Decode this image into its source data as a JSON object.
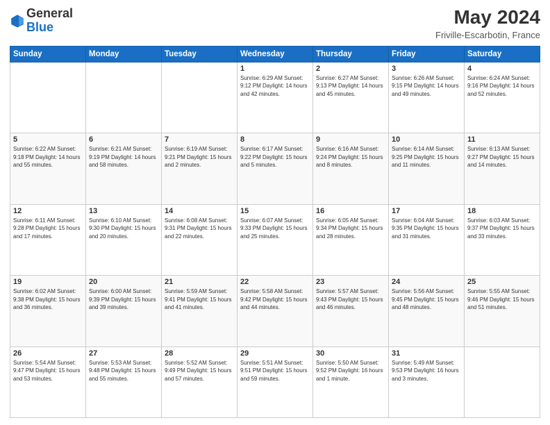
{
  "header": {
    "logo_general": "General",
    "logo_blue": "Blue",
    "title": "May 2024",
    "location": "Friville-Escarbotin, France"
  },
  "weekdays": [
    "Sunday",
    "Monday",
    "Tuesday",
    "Wednesday",
    "Thursday",
    "Friday",
    "Saturday"
  ],
  "weeks": [
    [
      {
        "day": "",
        "info": ""
      },
      {
        "day": "",
        "info": ""
      },
      {
        "day": "",
        "info": ""
      },
      {
        "day": "1",
        "info": "Sunrise: 6:29 AM\nSunset: 9:12 PM\nDaylight: 14 hours\nand 42 minutes."
      },
      {
        "day": "2",
        "info": "Sunrise: 6:27 AM\nSunset: 9:13 PM\nDaylight: 14 hours\nand 45 minutes."
      },
      {
        "day": "3",
        "info": "Sunrise: 6:26 AM\nSunset: 9:15 PM\nDaylight: 14 hours\nand 49 minutes."
      },
      {
        "day": "4",
        "info": "Sunrise: 6:24 AM\nSunset: 9:16 PM\nDaylight: 14 hours\nand 52 minutes."
      }
    ],
    [
      {
        "day": "5",
        "info": "Sunrise: 6:22 AM\nSunset: 9:18 PM\nDaylight: 14 hours\nand 55 minutes."
      },
      {
        "day": "6",
        "info": "Sunrise: 6:21 AM\nSunset: 9:19 PM\nDaylight: 14 hours\nand 58 minutes."
      },
      {
        "day": "7",
        "info": "Sunrise: 6:19 AM\nSunset: 9:21 PM\nDaylight: 15 hours\nand 2 minutes."
      },
      {
        "day": "8",
        "info": "Sunrise: 6:17 AM\nSunset: 9:22 PM\nDaylight: 15 hours\nand 5 minutes."
      },
      {
        "day": "9",
        "info": "Sunrise: 6:16 AM\nSunset: 9:24 PM\nDaylight: 15 hours\nand 8 minutes."
      },
      {
        "day": "10",
        "info": "Sunrise: 6:14 AM\nSunset: 9:25 PM\nDaylight: 15 hours\nand 11 minutes."
      },
      {
        "day": "11",
        "info": "Sunrise: 6:13 AM\nSunset: 9:27 PM\nDaylight: 15 hours\nand 14 minutes."
      }
    ],
    [
      {
        "day": "12",
        "info": "Sunrise: 6:11 AM\nSunset: 9:28 PM\nDaylight: 15 hours\nand 17 minutes."
      },
      {
        "day": "13",
        "info": "Sunrise: 6:10 AM\nSunset: 9:30 PM\nDaylight: 15 hours\nand 20 minutes."
      },
      {
        "day": "14",
        "info": "Sunrise: 6:08 AM\nSunset: 9:31 PM\nDaylight: 15 hours\nand 22 minutes."
      },
      {
        "day": "15",
        "info": "Sunrise: 6:07 AM\nSunset: 9:33 PM\nDaylight: 15 hours\nand 25 minutes."
      },
      {
        "day": "16",
        "info": "Sunrise: 6:05 AM\nSunset: 9:34 PM\nDaylight: 15 hours\nand 28 minutes."
      },
      {
        "day": "17",
        "info": "Sunrise: 6:04 AM\nSunset: 9:35 PM\nDaylight: 15 hours\nand 31 minutes."
      },
      {
        "day": "18",
        "info": "Sunrise: 6:03 AM\nSunset: 9:37 PM\nDaylight: 15 hours\nand 33 minutes."
      }
    ],
    [
      {
        "day": "19",
        "info": "Sunrise: 6:02 AM\nSunset: 9:38 PM\nDaylight: 15 hours\nand 36 minutes."
      },
      {
        "day": "20",
        "info": "Sunrise: 6:00 AM\nSunset: 9:39 PM\nDaylight: 15 hours\nand 39 minutes."
      },
      {
        "day": "21",
        "info": "Sunrise: 5:59 AM\nSunset: 9:41 PM\nDaylight: 15 hours\nand 41 minutes."
      },
      {
        "day": "22",
        "info": "Sunrise: 5:58 AM\nSunset: 9:42 PM\nDaylight: 15 hours\nand 44 minutes."
      },
      {
        "day": "23",
        "info": "Sunrise: 5:57 AM\nSunset: 9:43 PM\nDaylight: 15 hours\nand 46 minutes."
      },
      {
        "day": "24",
        "info": "Sunrise: 5:56 AM\nSunset: 9:45 PM\nDaylight: 15 hours\nand 48 minutes."
      },
      {
        "day": "25",
        "info": "Sunrise: 5:55 AM\nSunset: 9:46 PM\nDaylight: 15 hours\nand 51 minutes."
      }
    ],
    [
      {
        "day": "26",
        "info": "Sunrise: 5:54 AM\nSunset: 9:47 PM\nDaylight: 15 hours\nand 53 minutes."
      },
      {
        "day": "27",
        "info": "Sunrise: 5:53 AM\nSunset: 9:48 PM\nDaylight: 15 hours\nand 55 minutes."
      },
      {
        "day": "28",
        "info": "Sunrise: 5:52 AM\nSunset: 9:49 PM\nDaylight: 15 hours\nand 57 minutes."
      },
      {
        "day": "29",
        "info": "Sunrise: 5:51 AM\nSunset: 9:51 PM\nDaylight: 15 hours\nand 59 minutes."
      },
      {
        "day": "30",
        "info": "Sunrise: 5:50 AM\nSunset: 9:52 PM\nDaylight: 16 hours\nand 1 minute."
      },
      {
        "day": "31",
        "info": "Sunrise: 5:49 AM\nSunset: 9:53 PM\nDaylight: 16 hours\nand 3 minutes."
      },
      {
        "day": "",
        "info": ""
      }
    ]
  ]
}
